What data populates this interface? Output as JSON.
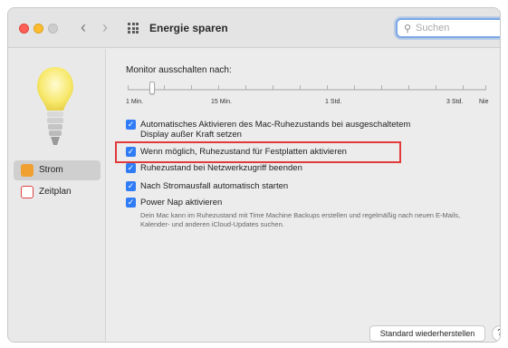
{
  "window": {
    "title": "Energie sparen",
    "search_placeholder": "Suchen"
  },
  "sidebar": {
    "items": [
      {
        "label": "Strom",
        "icon": "power-icon",
        "selected": true
      },
      {
        "label": "Zeitplan",
        "icon": "calendar-icon",
        "selected": false
      }
    ]
  },
  "slider": {
    "label": "Monitor ausschalten nach:",
    "ticks": [
      "1 Min.",
      "15 Min.",
      "1 Std.",
      "3 Std.",
      "Nie"
    ],
    "value_label": "1 Min."
  },
  "options": [
    {
      "label": "Automatisches Aktivieren des Mac-Ruhezustands bei ausgeschaltetem",
      "label_line2": "Display außer Kraft setzen",
      "checked": true
    },
    {
      "label": "Wenn möglich, Ruhezustand für Festplatten aktivieren",
      "checked": true
    },
    {
      "label": "Ruhezustand bei Netzwerkzugriff beenden",
      "checked": true
    },
    {
      "label": "Nach Stromausfall automatisch starten",
      "checked": true
    },
    {
      "label": "Power Nap aktivieren",
      "checked": true
    }
  ],
  "power_nap_description": "Dein Mac kann im Ruhezustand mit Time Machine Backups erstellen und regelmäßig nach neuen E-Mails, Kalender- und anderen iCloud-Updates suchen.",
  "buttons": {
    "restore": "Standard wiederherstellen",
    "help": "?"
  },
  "colors": {
    "accent": "#2f7cf6",
    "highlight": "#e23a3a"
  }
}
